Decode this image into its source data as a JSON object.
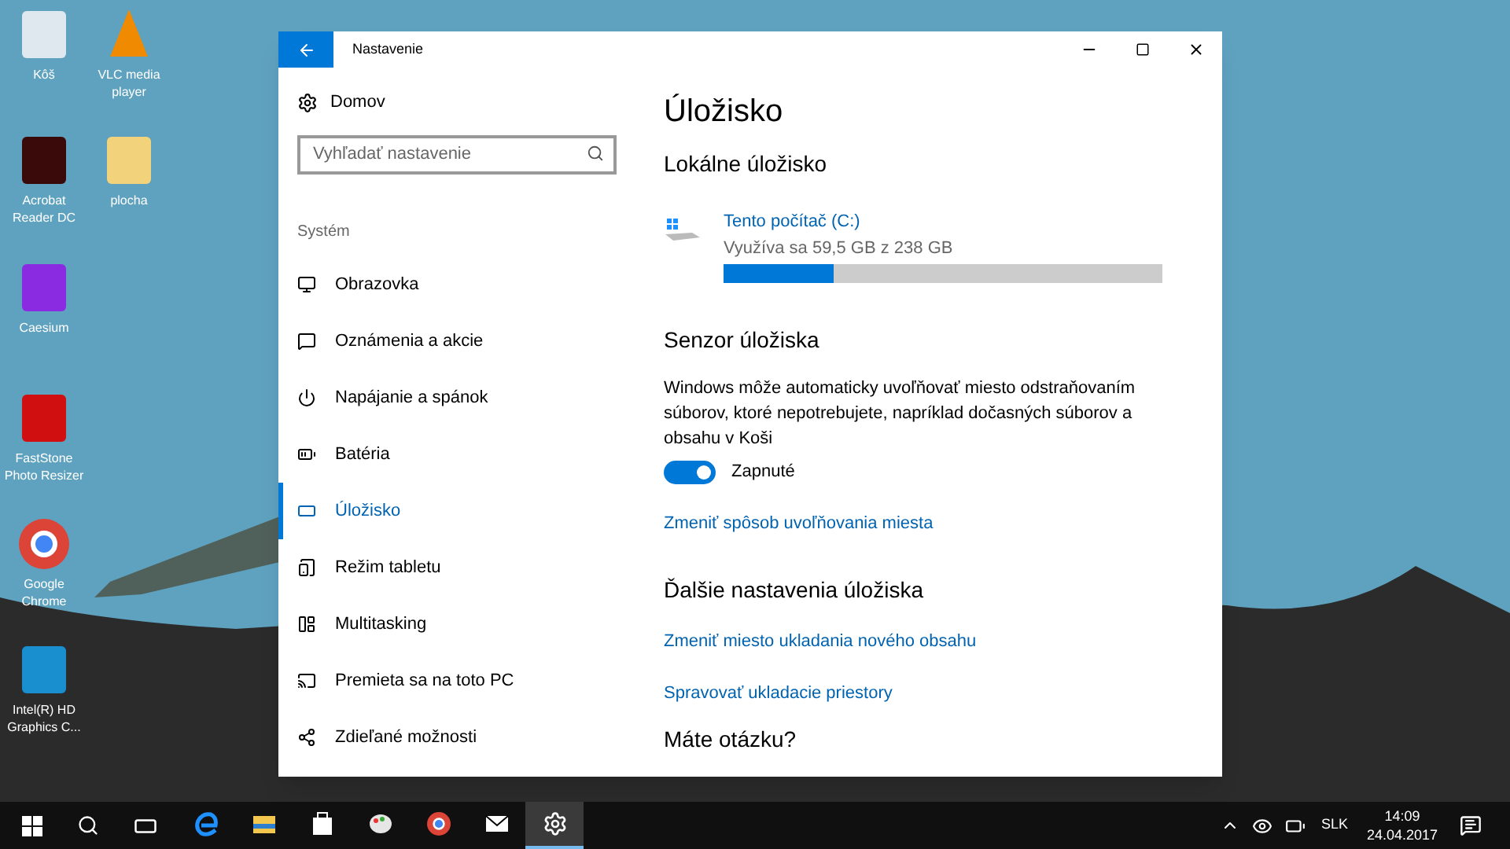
{
  "desktop_icons": [
    {
      "label": "Kôš"
    },
    {
      "label": "VLC media player"
    },
    {
      "label": "Acrobat Reader DC"
    },
    {
      "label": "plocha"
    },
    {
      "label": "Caesium"
    },
    {
      "label": "FastStone Photo Resizer"
    },
    {
      "label": "Google Chrome"
    },
    {
      "label": "Intel(R) HD Graphics C..."
    }
  ],
  "window": {
    "title": "Nastavenie"
  },
  "sidebar": {
    "home": "Domov",
    "search": {
      "placeholder": "Vyhľadať nastavenie"
    },
    "section": "Systém",
    "items": [
      {
        "label": "Obrazovka",
        "selected": false
      },
      {
        "label": "Oznámenia a akcie",
        "selected": false
      },
      {
        "label": "Napájanie a spánok",
        "selected": false
      },
      {
        "label": "Batéria",
        "selected": false
      },
      {
        "label": "Úložisko",
        "selected": true
      },
      {
        "label": "Režim tabletu",
        "selected": false
      },
      {
        "label": "Multitasking",
        "selected": false
      },
      {
        "label": "Premieta sa na toto PC",
        "selected": false
      },
      {
        "label": "Zdieľané možnosti",
        "selected": false
      }
    ]
  },
  "content": {
    "title": "Úložisko",
    "local_heading": "Lokálne úložisko",
    "drive": {
      "name": "Tento počítač (C:)",
      "usage": "Využíva sa 59,5 GB z 238 GB",
      "level": 0.25
    },
    "sense_heading": "Senzor úložiska",
    "sense_text": "Windows môže automaticky uvoľňovať miesto odstraňovaním súborov, ktoré nepotrebujete, napríklad dočasných súborov a obsahu v Koši",
    "toggle": {
      "on": true,
      "label": "Zapnuté"
    },
    "sense_link": "Zmeniť spôsob uvoľňovania miesta",
    "more_heading": "Ďalšie nastavenia úložiska",
    "more_links": [
      "Zmeniť miesto ukladania nového obsahu",
      "Spravovať ukladacie priestory"
    ],
    "question": "Máte otázku?"
  },
  "taskbar": {
    "apps": [
      {
        "selected": false
      },
      {
        "selected": false
      },
      {
        "selected": false
      },
      {
        "selected": false
      },
      {
        "selected": false
      },
      {
        "selected": false
      },
      {
        "selected": true
      }
    ],
    "language": "SLK",
    "time": "14:09",
    "date": "24.04.2017"
  }
}
